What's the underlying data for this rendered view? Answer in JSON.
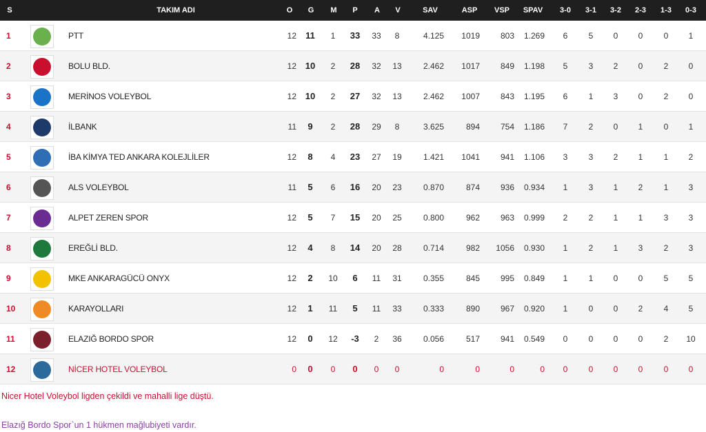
{
  "headers": {
    "rank": "S",
    "team": "TAKIM ADI",
    "played": "O",
    "won": "G",
    "lost": "M",
    "points": "P",
    "sets_won": "A",
    "sets_lost": "V",
    "sav": "SAV",
    "asp": "ASP",
    "vsp": "VSP",
    "spav": "SPAV",
    "r30": "3-0",
    "r31": "3-1",
    "r32": "3-2",
    "r23": "2-3",
    "r13": "1-3",
    "r03": "0-3"
  },
  "rows": [
    {
      "rank": "1",
      "team": "PTT",
      "logo": "ptt-logo",
      "logo_color": "#6ab04c",
      "o": "12",
      "g": "11",
      "m": "1",
      "p": "33",
      "a": "33",
      "v": "8",
      "sav": "4.125",
      "asp": "1019",
      "vsp": "803",
      "spav": "1.269",
      "r30": "6",
      "r31": "5",
      "r32": "0",
      "r23": "0",
      "r13": "0",
      "r03": "1"
    },
    {
      "rank": "2",
      "team": "BOLU BLD.",
      "logo": "bolu-logo",
      "logo_color": "#c8102e",
      "o": "12",
      "g": "10",
      "m": "2",
      "p": "28",
      "a": "32",
      "v": "13",
      "sav": "2.462",
      "asp": "1017",
      "vsp": "849",
      "spav": "1.198",
      "r30": "5",
      "r31": "3",
      "r32": "2",
      "r23": "0",
      "r13": "2",
      "r03": "0"
    },
    {
      "rank": "3",
      "team": "MERİNOS VOLEYBOL",
      "logo": "merinos-logo",
      "logo_color": "#1a73c6",
      "o": "12",
      "g": "10",
      "m": "2",
      "p": "27",
      "a": "32",
      "v": "13",
      "sav": "2.462",
      "asp": "1007",
      "vsp": "843",
      "spav": "1.195",
      "r30": "6",
      "r31": "1",
      "r32": "3",
      "r23": "0",
      "r13": "2",
      "r03": "0"
    },
    {
      "rank": "4",
      "team": "İLBANK",
      "logo": "ilbank-logo",
      "logo_color": "#1d3a6b",
      "o": "11",
      "g": "9",
      "m": "2",
      "p": "28",
      "a": "29",
      "v": "8",
      "sav": "3.625",
      "asp": "894",
      "vsp": "754",
      "spav": "1.186",
      "r30": "7",
      "r31": "2",
      "r32": "0",
      "r23": "1",
      "r13": "0",
      "r03": "1"
    },
    {
      "rank": "5",
      "team": "İBA KİMYA TED ANKARA KOLEJLİLER",
      "logo": "ted-logo",
      "logo_color": "#2f6db5",
      "o": "12",
      "g": "8",
      "m": "4",
      "p": "23",
      "a": "27",
      "v": "19",
      "sav": "1.421",
      "asp": "1041",
      "vsp": "941",
      "spav": "1.106",
      "r30": "3",
      "r31": "3",
      "r32": "2",
      "r23": "1",
      "r13": "1",
      "r03": "2"
    },
    {
      "rank": "6",
      "team": "ALS VOLEYBOL",
      "logo": "als-logo",
      "logo_color": "#555555",
      "o": "11",
      "g": "5",
      "m": "6",
      "p": "16",
      "a": "20",
      "v": "23",
      "sav": "0.870",
      "asp": "874",
      "vsp": "936",
      "spav": "0.934",
      "r30": "1",
      "r31": "3",
      "r32": "1",
      "r23": "2",
      "r13": "1",
      "r03": "3"
    },
    {
      "rank": "7",
      "team": "ALPET ZEREN SPOR",
      "logo": "zeren-logo",
      "logo_color": "#6a2c91",
      "o": "12",
      "g": "5",
      "m": "7",
      "p": "15",
      "a": "20",
      "v": "25",
      "sav": "0.800",
      "asp": "962",
      "vsp": "963",
      "spav": "0.999",
      "r30": "2",
      "r31": "2",
      "r32": "1",
      "r23": "1",
      "r13": "3",
      "r03": "3"
    },
    {
      "rank": "8",
      "team": "EREĞLİ BLD.",
      "logo": "eregli-logo",
      "logo_color": "#1e7a3c",
      "o": "12",
      "g": "4",
      "m": "8",
      "p": "14",
      "a": "20",
      "v": "28",
      "sav": "0.714",
      "asp": "982",
      "vsp": "1056",
      "spav": "0.930",
      "r30": "1",
      "r31": "2",
      "r32": "1",
      "r23": "3",
      "r13": "2",
      "r03": "3"
    },
    {
      "rank": "9",
      "team": "MKE ANKARAGÜCÜ ONYX",
      "logo": "ankaragucu-logo",
      "logo_color": "#f2c200",
      "o": "12",
      "g": "2",
      "m": "10",
      "p": "6",
      "a": "11",
      "v": "31",
      "sav": "0.355",
      "asp": "845",
      "vsp": "995",
      "spav": "0.849",
      "r30": "1",
      "r31": "1",
      "r32": "0",
      "r23": "0",
      "r13": "5",
      "r03": "5"
    },
    {
      "rank": "10",
      "team": "KARAYOLLARI",
      "logo": "karayollari-logo",
      "logo_color": "#f08a24",
      "o": "12",
      "g": "1",
      "m": "11",
      "p": "5",
      "a": "11",
      "v": "33",
      "sav": "0.333",
      "asp": "890",
      "vsp": "967",
      "spav": "0.920",
      "r30": "1",
      "r31": "0",
      "r32": "0",
      "r23": "2",
      "r13": "4",
      "r03": "5"
    },
    {
      "rank": "11",
      "team": "ELAZIĞ BORDO SPOR",
      "logo": "bordo-logo",
      "logo_color": "#7a1f2b",
      "o": "12",
      "g": "0",
      "m": "12",
      "p": "-3",
      "a": "2",
      "v": "36",
      "sav": "0.056",
      "asp": "517",
      "vsp": "941",
      "spav": "0.549",
      "r30": "0",
      "r31": "0",
      "r32": "0",
      "r23": "0",
      "r13": "2",
      "r03": "10"
    },
    {
      "rank": "12",
      "team": "NİCER HOTEL VOLEYBOL",
      "logo": "nicer-logo",
      "logo_color": "#2b6a9a",
      "o": "0",
      "g": "0",
      "m": "0",
      "p": "0",
      "a": "0",
      "v": "0",
      "sav": "0",
      "asp": "0",
      "vsp": "0",
      "spav": "0",
      "r30": "0",
      "r31": "0",
      "r32": "0",
      "r23": "0",
      "r13": "0",
      "r03": "0",
      "withdrawn": true
    }
  ],
  "notes": {
    "withdrawn": "Nicer Hotel Voleybol ligden çekildi ve mahalli lige düştü.",
    "penalty": "Elazığ Bordo Spor`un 1 hükmen mağlubiyeti vardır."
  },
  "colors": {
    "header_bg": "#1f1f1f",
    "rank_red": "#c8102e",
    "note_purple": "#8b3fa0"
  }
}
